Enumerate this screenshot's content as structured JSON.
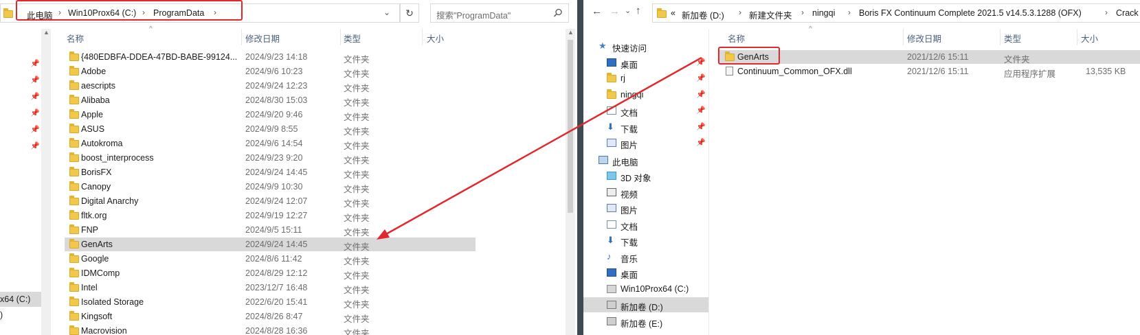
{
  "left": {
    "breadcrumb": [
      "此电脑",
      "Win10Prox64 (C:)",
      "ProgramData"
    ],
    "search_placeholder": "搜索\"ProgramData\"",
    "columns": [
      "名称",
      "修改日期",
      "类型",
      "大小"
    ],
    "nav_labels": [
      "x64 (C:)",
      ")"
    ],
    "rows": [
      {
        "name": "{480EDBFA-DDEA-47BD-BABE-99124...",
        "date": "2024/9/23 14:18",
        "type": "文件夹"
      },
      {
        "name": "Adobe",
        "date": "2024/9/6 10:23",
        "type": "文件夹"
      },
      {
        "name": "aescripts",
        "date": "2024/9/24 12:23",
        "type": "文件夹"
      },
      {
        "name": "Alibaba",
        "date": "2024/8/30 15:03",
        "type": "文件夹"
      },
      {
        "name": "Apple",
        "date": "2024/9/20 9:46",
        "type": "文件夹"
      },
      {
        "name": "ASUS",
        "date": "2024/9/9 8:55",
        "type": "文件夹"
      },
      {
        "name": "Autokroma",
        "date": "2024/9/6 14:54",
        "type": "文件夹"
      },
      {
        "name": "boost_interprocess",
        "date": "2024/9/23 9:20",
        "type": "文件夹"
      },
      {
        "name": "BorisFX",
        "date": "2024/9/24 14:45",
        "type": "文件夹"
      },
      {
        "name": "Canopy",
        "date": "2024/9/9 10:30",
        "type": "文件夹"
      },
      {
        "name": "Digital Anarchy",
        "date": "2024/9/24 12:07",
        "type": "文件夹"
      },
      {
        "name": "fltk.org",
        "date": "2024/9/19 12:27",
        "type": "文件夹"
      },
      {
        "name": "FNP",
        "date": "2024/9/5 15:11",
        "type": "文件夹"
      },
      {
        "name": "GenArts",
        "date": "2024/9/24 14:45",
        "type": "文件夹",
        "selected": true
      },
      {
        "name": "Google",
        "date": "2024/8/6 11:42",
        "type": "文件夹"
      },
      {
        "name": "IDMComp",
        "date": "2024/8/29 12:12",
        "type": "文件夹"
      },
      {
        "name": "Intel",
        "date": "2023/12/7 16:48",
        "type": "文件夹"
      },
      {
        "name": "Isolated Storage",
        "date": "2022/6/20 15:41",
        "type": "文件夹"
      },
      {
        "name": "Kingsoft",
        "date": "2024/8/26 8:47",
        "type": "文件夹"
      },
      {
        "name": "Macrovision",
        "date": "2024/8/28 16:36",
        "type": "文件夹"
      }
    ]
  },
  "right": {
    "breadcrumb_prefix": "«",
    "breadcrumb": [
      "新加卷 (D:)",
      "新建文件夹",
      "ningqi",
      "Boris FX Continuum Complete 2021.5 v14.5.3.1288 (OFX)",
      "Crack"
    ],
    "columns": [
      "名称",
      "修改日期",
      "类型",
      "大小"
    ],
    "rows": [
      {
        "name": "GenArts",
        "date": "2021/12/6 15:11",
        "type": "文件夹",
        "size": "",
        "icon": "folder-icon",
        "selected": true
      },
      {
        "name": "Continuum_Common_OFX.dll",
        "date": "2021/12/6 15:11",
        "type": "应用程序扩展",
        "size": "13,535 KB",
        "icon": "dll-file-icon"
      }
    ],
    "nav": [
      {
        "label": "快速访问",
        "icon": "star-icon"
      },
      {
        "label": "桌面",
        "icon": "desktop-icon",
        "pinned": true
      },
      {
        "label": "rj",
        "icon": "folder-icon",
        "pinned": true
      },
      {
        "label": "ningqi",
        "icon": "folder-icon",
        "pinned": true
      },
      {
        "label": "文档",
        "icon": "document-icon",
        "pinned": true
      },
      {
        "label": "下载",
        "icon": "download-icon",
        "pinned": true
      },
      {
        "label": "图片",
        "icon": "picture-icon",
        "pinned": true
      },
      {
        "label": "此电脑",
        "icon": "computer-icon"
      },
      {
        "label": "3D 对象",
        "icon": "3d-objects-icon"
      },
      {
        "label": "视频",
        "icon": "video-icon"
      },
      {
        "label": "图片",
        "icon": "picture-icon"
      },
      {
        "label": "文档",
        "icon": "document-icon"
      },
      {
        "label": "下载",
        "icon": "download-icon"
      },
      {
        "label": "音乐",
        "icon": "music-icon"
      },
      {
        "label": "桌面",
        "icon": "desktop-icon"
      },
      {
        "label": "Win10Prox64 (C:)",
        "icon": "drive-c-icon"
      },
      {
        "label": "新加卷 (D:)",
        "icon": "drive-d-icon",
        "selected": true
      },
      {
        "label": "新加卷 (E:)",
        "icon": "drive-e-icon"
      }
    ]
  },
  "colors": {
    "highlight_red": "#e0282e",
    "selection_gray": "#d9d9d9",
    "folder_yellow": "#f2c84b",
    "divider": "#3e4a52",
    "header_text": "#4c607a"
  }
}
